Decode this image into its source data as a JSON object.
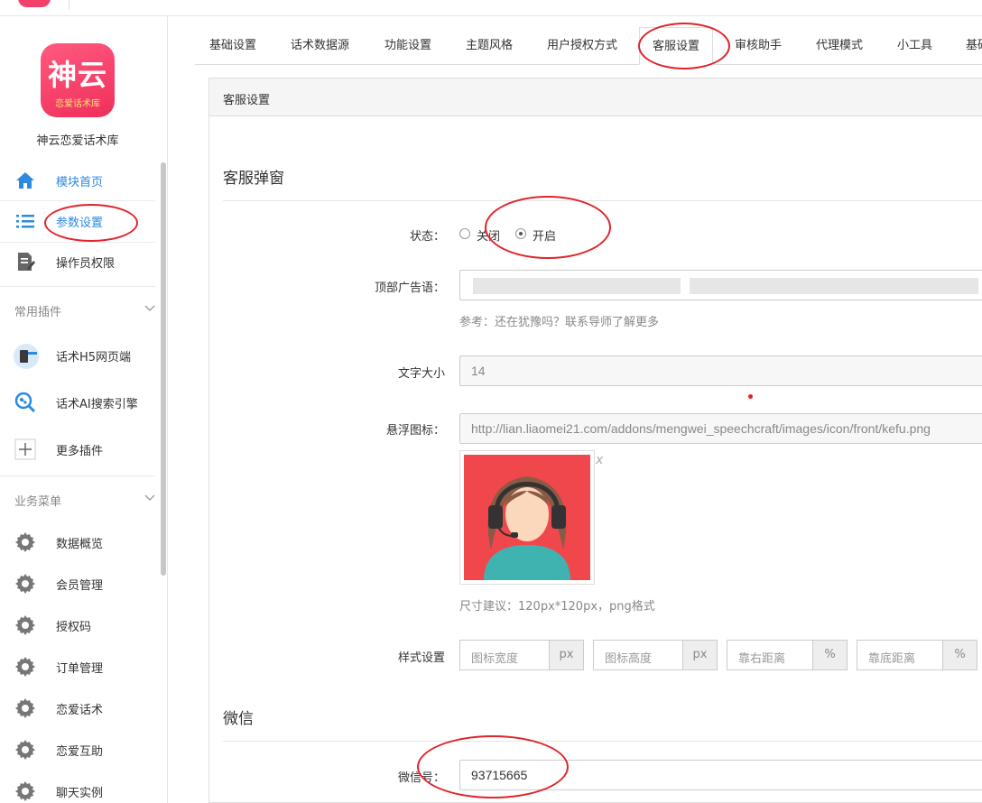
{
  "sidebar": {
    "logo_text": "神云",
    "logo_sub": "恋爱话术库",
    "app_name": "神云恋爱话术库",
    "top_items": [
      {
        "label": "模块首页",
        "icon": "home-icon"
      },
      {
        "label": "参数设置",
        "icon": "list-settings-icon"
      },
      {
        "label": "操作员权限",
        "icon": "document-edit-icon"
      }
    ],
    "plugin_group": "常用插件",
    "plugin_items": [
      {
        "label": "话术H5网页端",
        "icon": "h5-page-icon"
      },
      {
        "label": "话术AI搜索引擎",
        "icon": "ai-search-icon"
      },
      {
        "label": "更多插件",
        "icon": "plus-icon"
      }
    ],
    "business_group": "业务菜单",
    "business_items": [
      {
        "label": "数据概览"
      },
      {
        "label": "会员管理"
      },
      {
        "label": "授权码"
      },
      {
        "label": "订单管理"
      },
      {
        "label": "恋爱话术"
      },
      {
        "label": "恋爱互助"
      },
      {
        "label": "聊天实例"
      }
    ]
  },
  "tabs": [
    "基础设置",
    "话术数据源",
    "功能设置",
    "主题风格",
    "用户授权方式",
    "客服设置",
    "审核助手",
    "代理模式",
    "小工具",
    "基础"
  ],
  "active_tab": "客服设置",
  "panel": {
    "heading": "客服设置",
    "section1": "客服弹窗",
    "status_label": "状态：",
    "status_off": "关闭",
    "status_on": "开启",
    "status_value": "开启",
    "ad_label": "顶部广告语：",
    "ad_help": "参考：还在犹豫吗？联系导师了解更多",
    "font_label": "文字大小",
    "font_value": "14",
    "icon_label": "悬浮图标：",
    "icon_value": "http://lian.liaomei21.com/addons/mengwei_speechcraft/images/icon/front/kefu.png",
    "icon_close": "x",
    "icon_help": "尺寸建议：120px*120px，png格式",
    "style_label": "样式设置",
    "style_inputs": [
      {
        "placeholder": "图标宽度",
        "unit": "px"
      },
      {
        "placeholder": "图标高度",
        "unit": "px"
      },
      {
        "placeholder": "靠右距离",
        "unit": "%"
      },
      {
        "placeholder": "靠底距离",
        "unit": "%"
      }
    ],
    "section2": "微信",
    "wechat_label": "微信号：",
    "wechat_value": "93715665"
  },
  "colors": {
    "accent": "#2c8ae0",
    "logo": "#ef2f5a",
    "annotation": "#e0242b",
    "avatar_bg": "#f0474c"
  }
}
